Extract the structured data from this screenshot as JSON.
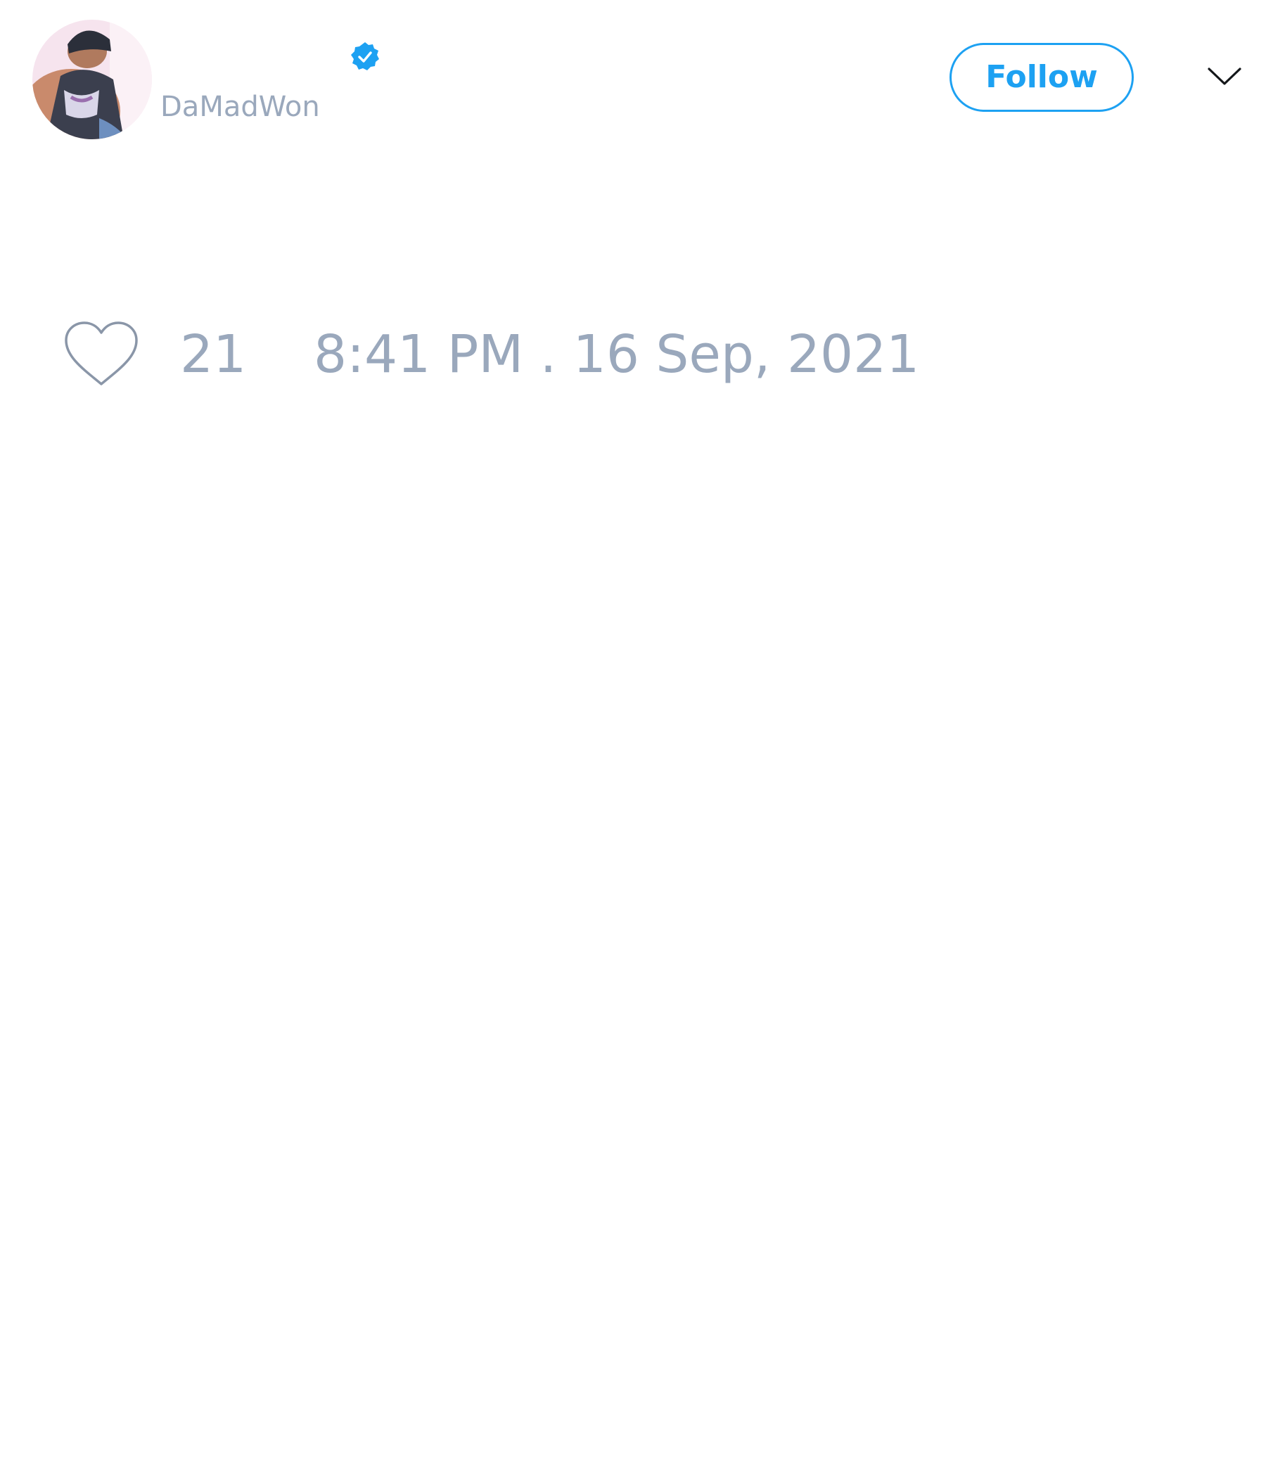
{
  "tweet": {
    "author": {
      "handle": "DaMadWon",
      "verified": true,
      "avatar_icon": "avatar-photo"
    },
    "follow_button_label": "Follow",
    "menu_icon": "chevron-down-icon",
    "stats": {
      "like_icon": "heart-icon",
      "like_count": "21",
      "timestamp": "8:41 PM . 16 Sep, 2021"
    }
  },
  "colors": {
    "accent": "#1da1f2",
    "muted_text": "#9aa8bc",
    "background": "#ffffff"
  }
}
